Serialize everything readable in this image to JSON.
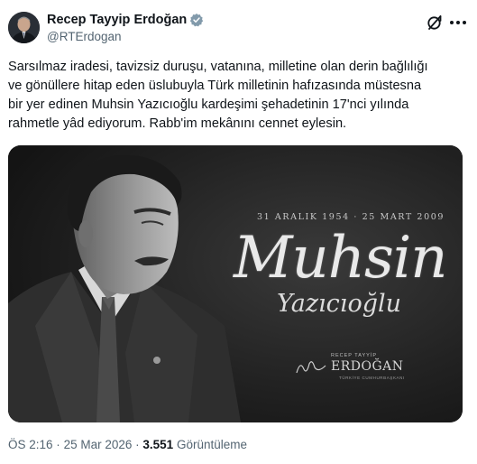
{
  "author": {
    "display_name": "Recep Tayyip Erdoğan",
    "handle": "@RTErdogan",
    "verified_badge": "verified-badge-icon",
    "verified_color": "#829aab"
  },
  "header_actions": {
    "grok_icon": "grok-icon",
    "more_icon": "more-dots-icon"
  },
  "tweet": {
    "lines": [
      "Sarsılmaz iradesi, tavizsiz duruşu, vatanına, milletine olan derin bağlılığı",
      "ve gönüllere hitap eden üslubuyla Türk milletinin hafızasında müstesna",
      "bir yer edinen Muhsin Yazıcıoğlu kardeşimi şehadetinin 17'nci yılında",
      "rahmetle yâd ediyorum. Rabb'im mekânını cennet eylesin."
    ]
  },
  "media": {
    "dates": "31 ARALIK 1954 · 25 MART 2009",
    "first_name": "Muhsin",
    "last_name": "Yazıcıoğlu",
    "signature": {
      "small": "RECEP TAYYİP",
      "name": "ERDOĞAN",
      "title": "TÜRKİYE CUMHURBAŞKANI"
    }
  },
  "footer": {
    "time": "ÖS 2:16",
    "separator": "·",
    "date": "25 Mar 2026",
    "views": "3.551",
    "views_label": "Görüntüleme"
  }
}
